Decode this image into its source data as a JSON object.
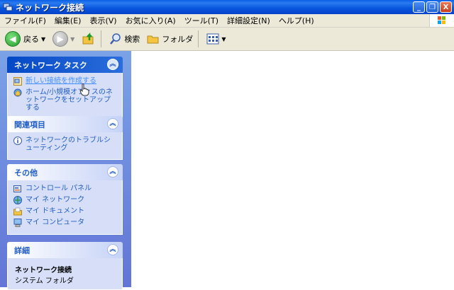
{
  "window": {
    "title": "ネットワーク接続",
    "minimize": "_",
    "restore": "❐",
    "close": "X"
  },
  "menu": [
    "ファイル(F)",
    "編集(E)",
    "表示(V)",
    "お気に入り(A)",
    "ツール(T)",
    "詳細設定(N)",
    "ヘルプ(H)"
  ],
  "toolbar": {
    "back_label": "戻る",
    "search_label": "検索",
    "folders_label": "フォルダ"
  },
  "panels": {
    "network_tasks": {
      "title": "ネットワーク タスク",
      "items": [
        "新しい接続を作成する",
        "ホーム/小規模オフィスのネットワークをセットアップする"
      ]
    },
    "related": {
      "title": "関連項目",
      "items": [
        "ネットワークのトラブルシューティング"
      ]
    },
    "other": {
      "title": "その他",
      "items": [
        "コントロール パネル",
        "マイ ネットワーク",
        "マイ ドキュメント",
        "マイ コンピュータ"
      ]
    },
    "details": {
      "title": "詳細",
      "name": "ネットワーク接続",
      "type": "システム フォルダ"
    }
  },
  "colors": {
    "titlebar": "#0a5fe4",
    "pane": "#7ba2e7",
    "link": "#215dc6"
  }
}
